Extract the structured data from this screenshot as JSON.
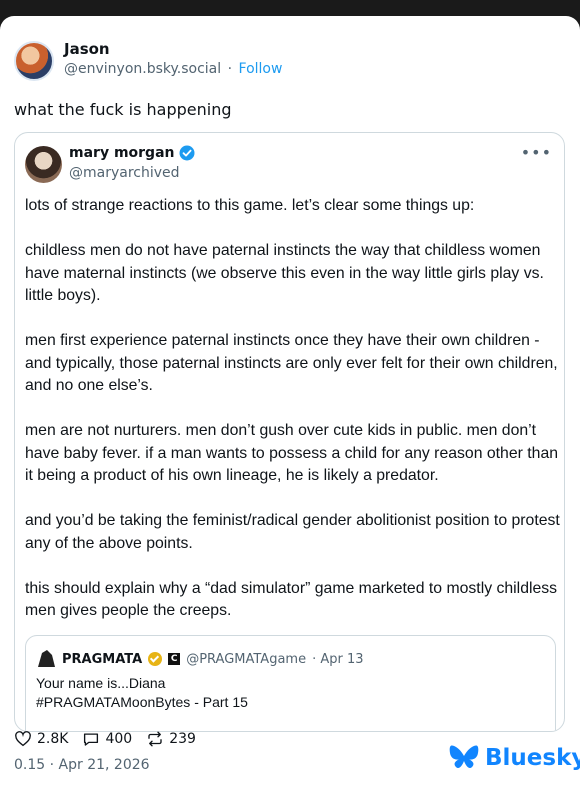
{
  "post": {
    "author_name": "Jason",
    "author_handle": "@envinyon.bsky.social",
    "separator": "·",
    "follow_label": "Follow",
    "text": "what the fuck is happening"
  },
  "quote": {
    "author_name": "mary morgan",
    "author_handle": "@maryarchived",
    "more_label": "•••",
    "paragraphs": [
      "lots of strange reactions to this game. let’s clear some things up:",
      "childless men do not have paternal instincts the way that childless women have maternal instincts (we observe this even in the way little girls play vs. little boys).",
      "men first experience paternal instincts once they have their own children - and typically, those paternal instincts are only ever felt for their own children, and no one else’s.",
      "men are not nurturers. men don’t gush over cute kids in public. men don’t have baby fever. if a man wants to possess a child for any reason other than it being a product of his own lineage, he is likely a predator.",
      "and you’d be taking the feminist/radical gender abolitionist position to protest any of the above points.",
      "this should explain why a “dad simulator” game marketed to mostly childless men gives people the creeps."
    ],
    "nested": {
      "author_name": "PRAGMATA",
      "c_label": "C",
      "author_handle": "@PRAGMATAgame",
      "date": "· Apr 13",
      "line1": "Your name is...Diana",
      "line2": "#PRAGMATAMoonBytes - Part 15"
    }
  },
  "stats": {
    "likes": "2.8K",
    "replies": "400",
    "reposts": "239"
  },
  "timestamp": "0.15 · Apr 21, 2026",
  "brand": {
    "name": "Bluesky",
    "color": "#1185fe"
  },
  "colors": {
    "link": "#1d9bf0",
    "muted": "#536471",
    "verified": "#1d9bf0",
    "gold_badge": "#e7b416"
  }
}
